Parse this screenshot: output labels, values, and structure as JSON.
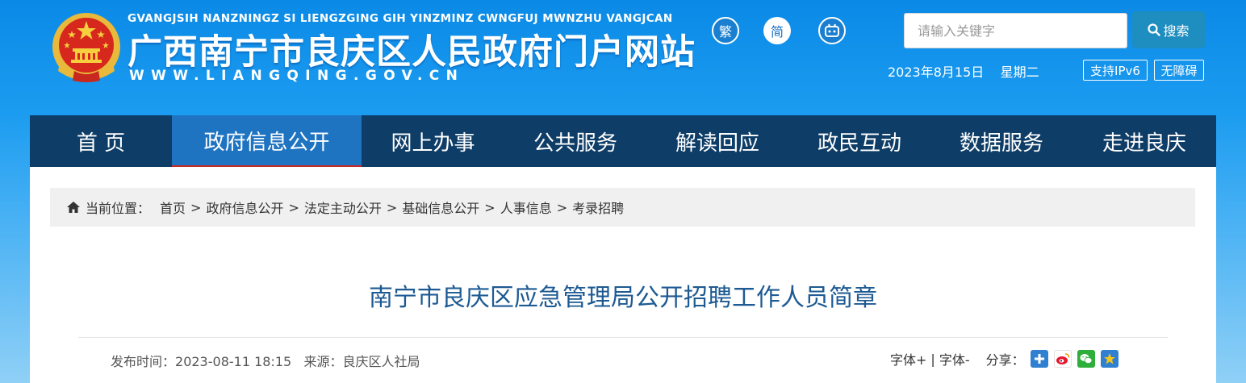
{
  "header": {
    "site_pinyin": "GVANGJSIH NANZNINGZ SI LIENGZGING GIH YINZMINZ CWNGFUJ MWNZHU VANGJCAN",
    "site_title": "广西南宁市良庆区人民政府门户网站",
    "site_url": "WWW.LIANGQING.GOV.CN",
    "lang_traditional": "繁",
    "lang_simplified": "简",
    "robot_icon": "robot-icon",
    "search_placeholder": "请输入关键字",
    "search_button": "搜索",
    "date": "2023年8月15日",
    "weekday": "星期二",
    "ipv6_label": "支持IPv6",
    "accessibility_label": "无障碍"
  },
  "nav": {
    "items": [
      {
        "label": "首 页"
      },
      {
        "label": "政府信息公开"
      },
      {
        "label": "网上办事"
      },
      {
        "label": "公共服务"
      },
      {
        "label": "解读回应"
      },
      {
        "label": "政民互动"
      },
      {
        "label": "数据服务"
      },
      {
        "label": "走进良庆"
      }
    ],
    "active_index": 1
  },
  "breadcrumb": {
    "prefix": "当前位置：",
    "items": [
      "首页",
      "政府信息公开",
      "法定主动公开",
      "基础信息公开",
      "人事信息",
      "考录招聘"
    ],
    "separator": ">"
  },
  "article": {
    "title": "南宁市良庆区应急管理局公开招聘工作人员简章",
    "publish_label": "发布时间：",
    "publish_time": "2023-08-11 18:15",
    "source_label": "来源：",
    "source": "良庆区人社局",
    "font_increase": "字体+",
    "font_sep": "|",
    "font_decrease": "字体-",
    "share_label": "分享："
  },
  "colors": {
    "nav_bg": "#0e3d67",
    "nav_active": "#1f74c2",
    "title": "#1d5a93",
    "search_btn": "#1e8dbf"
  }
}
